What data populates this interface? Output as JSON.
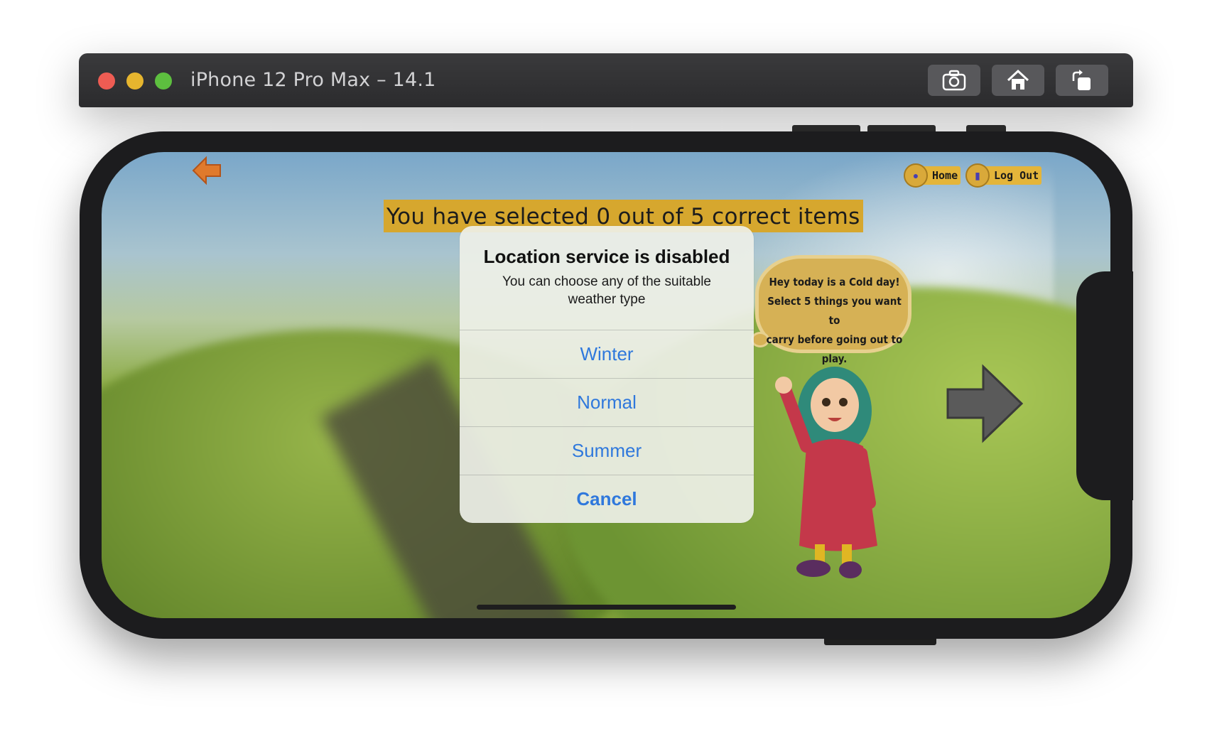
{
  "window": {
    "title": "iPhone 12 Pro Max – 14.1",
    "toolbar": {
      "screenshot_icon": "camera-icon",
      "home_icon": "home-icon",
      "rotate_icon": "rotate-icon"
    }
  },
  "app": {
    "score_text": "You have selected 0 out of 5 correct items",
    "nav": {
      "home_label": "Home",
      "logout_label": "Log Out"
    },
    "speech_bubble": {
      "line1": "Hey today is a Cold day!",
      "line2": "Select 5 things you want to",
      "line3": "carry before going out to",
      "line4": "play."
    }
  },
  "alert": {
    "title": "Location service is disabled",
    "message": "You can choose any of the suitable weather type",
    "options": [
      {
        "label": "Winter"
      },
      {
        "label": "Normal"
      },
      {
        "label": "Summer"
      }
    ],
    "cancel_label": "Cancel"
  },
  "colors": {
    "alert_button": "#2f78dc",
    "score_highlight": "#d6a72e",
    "titlebar": "#2b2b2d"
  }
}
